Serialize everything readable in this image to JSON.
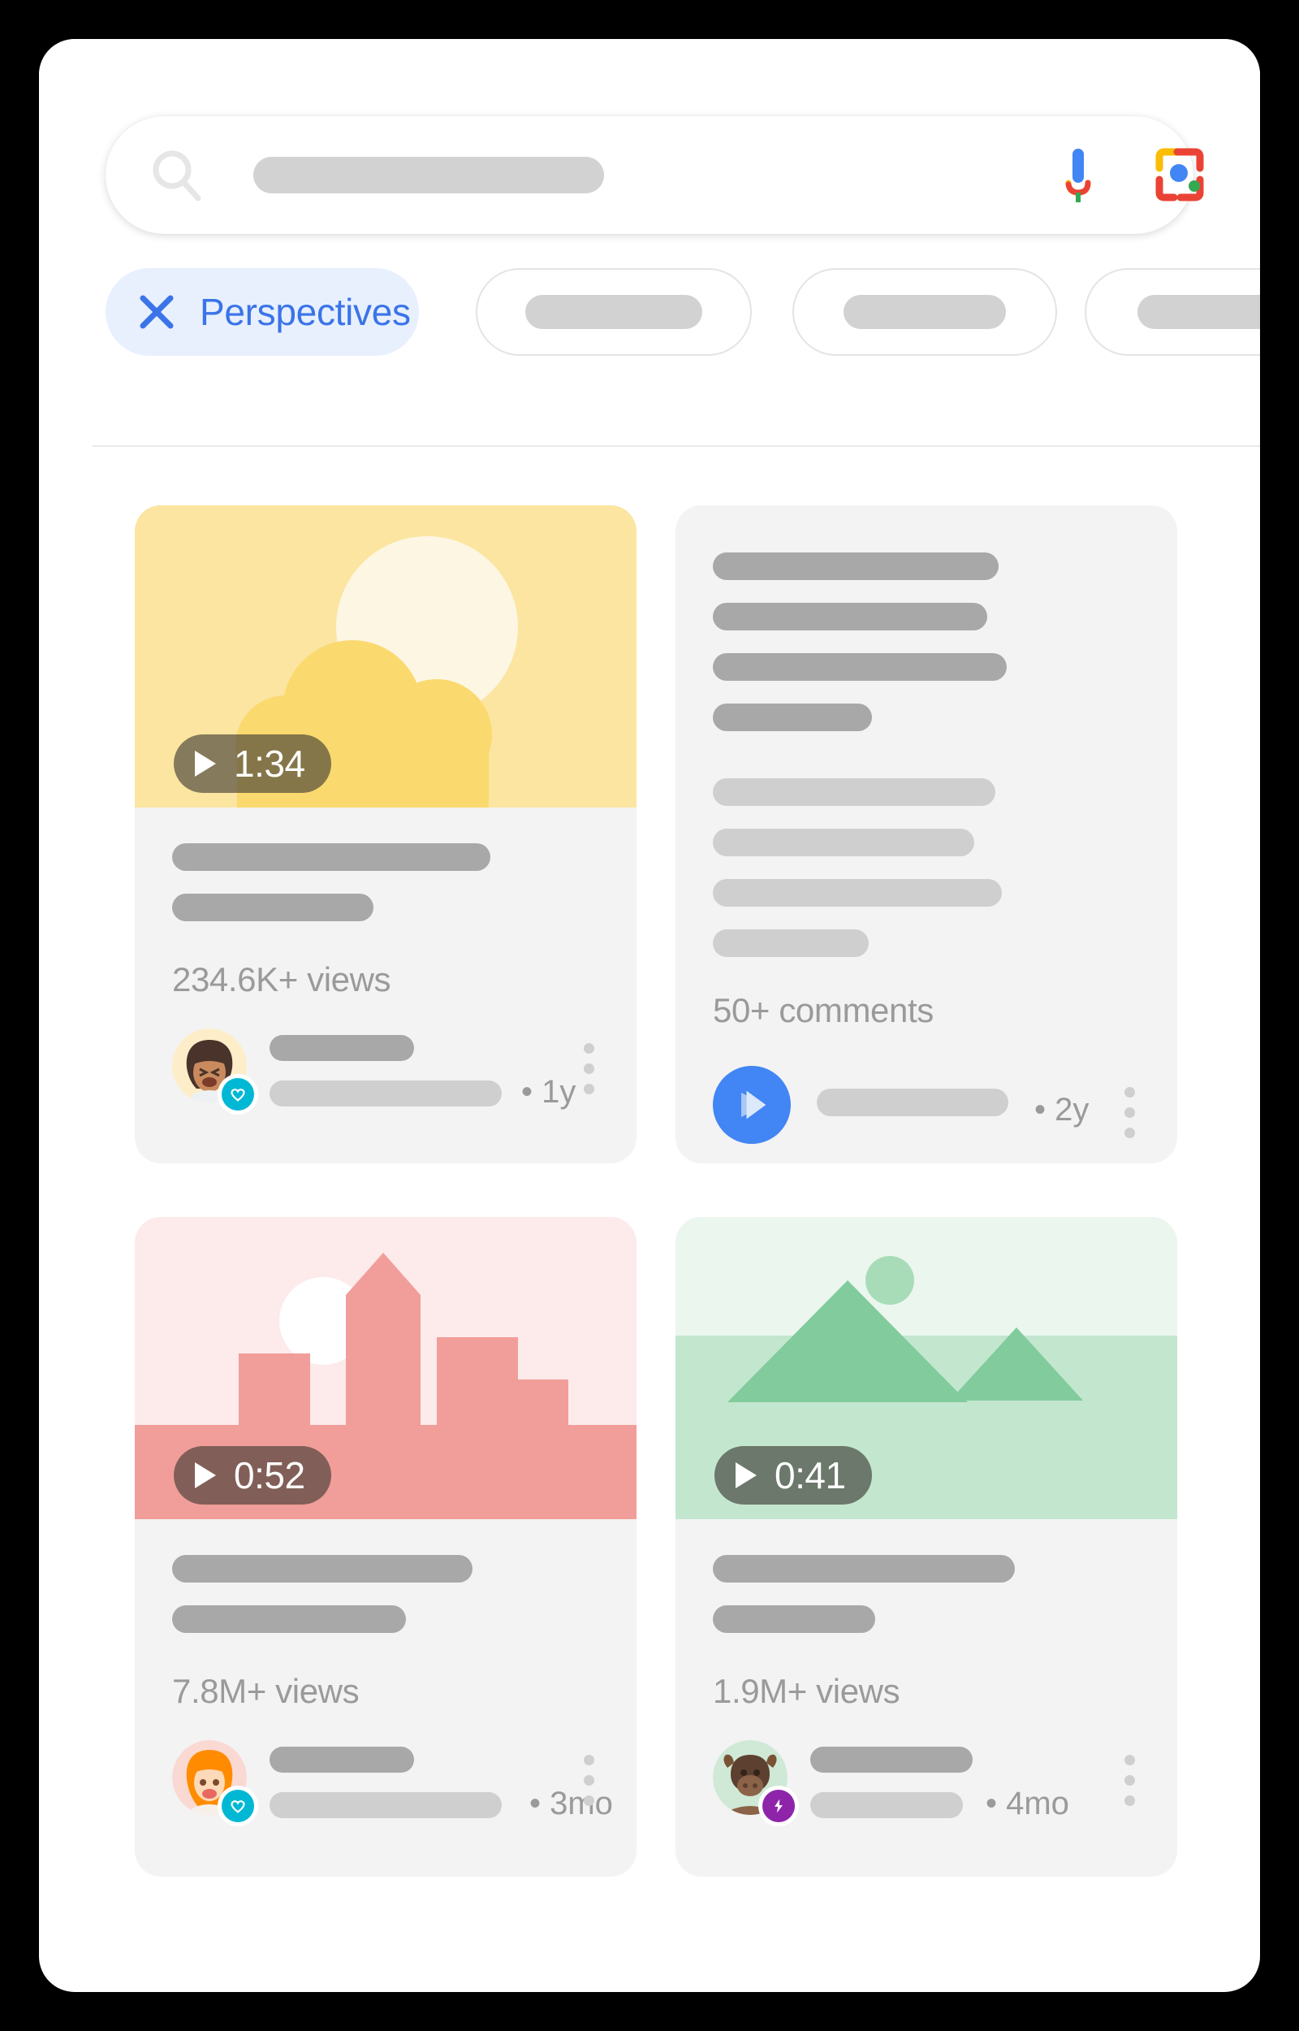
{
  "search": {
    "icon": "search-icon",
    "placeholder_value": "",
    "mic_icon": "mic-icon",
    "lens_icon": "google-lens-icon"
  },
  "filters": {
    "active_chip": {
      "label": "Perspectives",
      "close_icon": "close-x-icon",
      "text_color": "#3b74e8",
      "bg_color": "#e8f0fe"
    },
    "ghost_chips": [
      {
        "label": ""
      },
      {
        "label": ""
      },
      {
        "label": ""
      }
    ]
  },
  "cards": [
    {
      "thumbnail": "sun-clouds-illustration",
      "duration": "1:34",
      "play_icon": "play-triangle-icon",
      "stat": "234.6K+ views",
      "avatar": "woman-avatar",
      "badge": "heart-verified-badge",
      "badge_color": "#00b8d4",
      "time": "• 1y",
      "menu_icon": "more-vertical-icon"
    },
    {
      "thumbnail": "text-skeleton",
      "stat": "50+ comments",
      "avatar": "google-play-icon",
      "badge_color": "#4285f4",
      "time": "• 2y",
      "menu_icon": "more-vertical-icon"
    },
    {
      "thumbnail": "city-skyline-illustration",
      "duration": "0:52",
      "play_icon": "play-triangle-icon",
      "stat": "7.8M+ views",
      "avatar": "red-haired-woman-avatar",
      "badge": "heart-verified-badge",
      "badge_color": "#00b8d4",
      "time": "• 3mo",
      "menu_icon": "more-vertical-icon"
    },
    {
      "thumbnail": "mountains-illustration",
      "duration": "0:41",
      "play_icon": "play-triangle-icon",
      "stat": "1.9M+ views",
      "avatar": "bison-avatar",
      "badge": "lightning-badge",
      "badge_color": "#8e24aa",
      "time": "• 4mo",
      "menu_icon": "more-vertical-icon"
    }
  ]
}
